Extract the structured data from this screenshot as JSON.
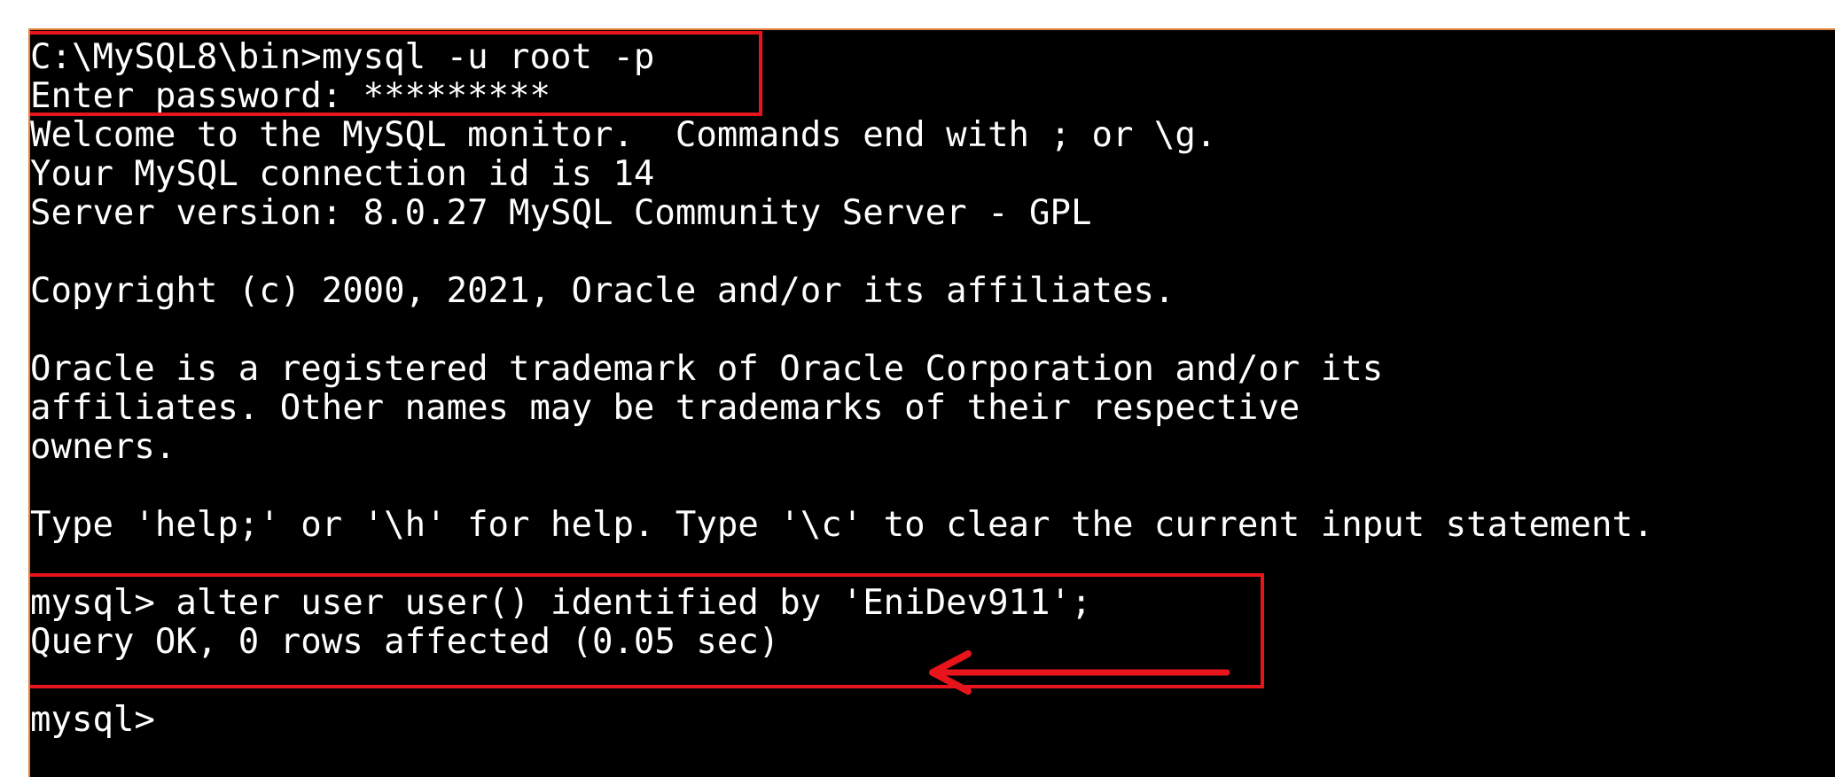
{
  "terminal": {
    "lines": [
      "C:\\MySQL8\\bin>mysql -u root -p",
      "Enter password: *********",
      "Welcome to the MySQL monitor.  Commands end with ; or \\g.",
      "Your MySQL connection id is 14",
      "Server version: 8.0.27 MySQL Community Server - GPL",
      "",
      "Copyright (c) 2000, 2021, Oracle and/or its affiliates.",
      "",
      "Oracle is a registered trademark of Oracle Corporation and/or its",
      "affiliates. Other names may be trademarks of their respective",
      "owners.",
      "",
      "Type 'help;' or '\\h' for help. Type '\\c' to clear the current input statement.",
      "",
      "mysql> alter user user() identified by 'EniDev911';",
      "Query OK, 0 rows affected (0.05 sec)",
      "",
      "mysql>"
    ]
  },
  "colors": {
    "background": "#000000",
    "text": "#ffffff",
    "highlight": "#e8141c",
    "frame": "#e0803a"
  }
}
